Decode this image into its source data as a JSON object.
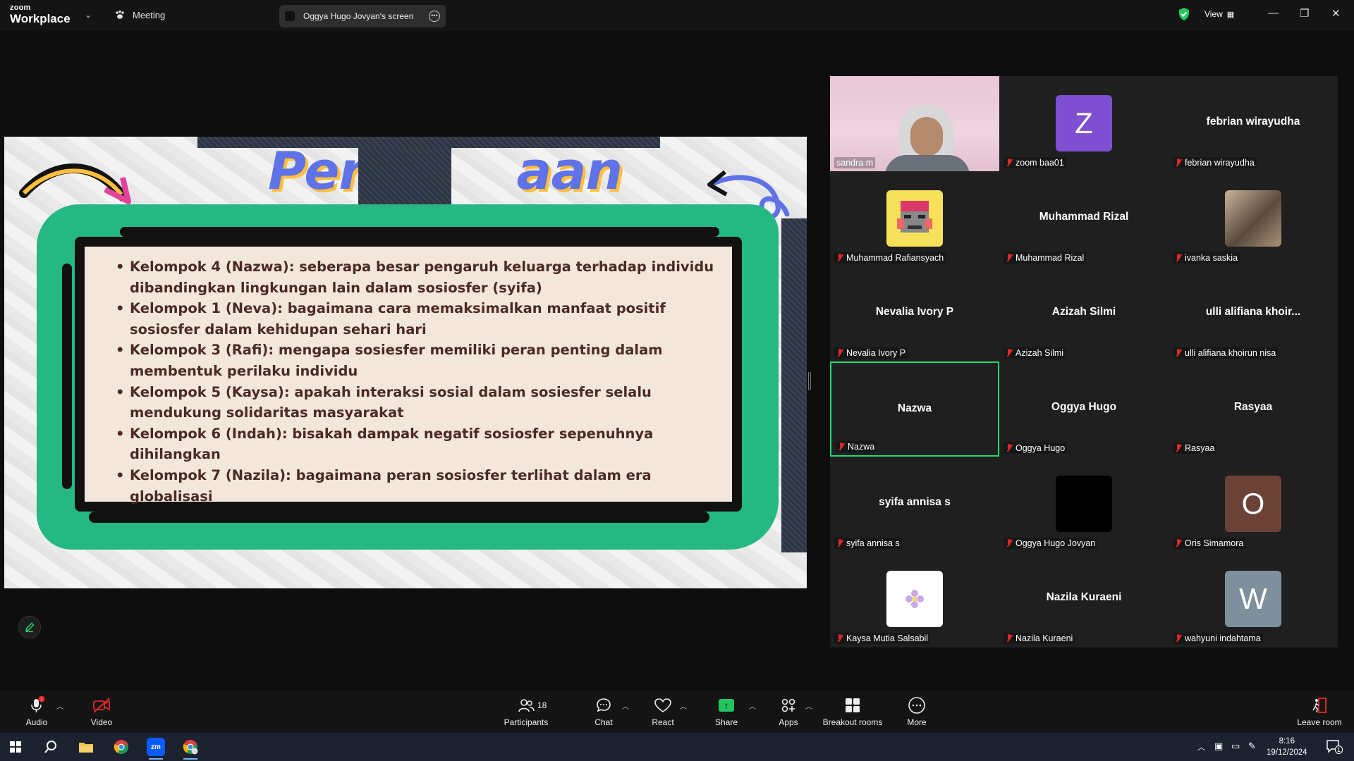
{
  "app": {
    "logo_line1": "zoom",
    "logo_line2": "Workplace",
    "meeting_label": "Meeting",
    "share_indicator": "Oggya Hugo Jovyan's screen",
    "view_label": "View"
  },
  "slide": {
    "title_visible_left": "Pert",
    "title_visible_right": "aan",
    "items": [
      "Kelompok 4 (Nazwa): seberapa besar pengaruh keluarga terhadap individu dibandingkan lingkungan lain dalam sosiosfer (syifa)",
      "Kelompok 1 (Neva): bagaimana cara memaksimalkan manfaat positif sosiosfer dalam kehidupan sehari hari",
      "Kelompok 3 (Rafi): mengapa sosiesfer memiliki peran penting dalam membentuk perilaku individu",
      "Kelompok 5 (Kaysa): apakah interaksi sosial dalam sosiesfer selalu mendukung solidaritas masyarakat",
      "Kelompok 6 (Indah): bisakah dampak negatif sosiosfer sepenuhnya dihilangkan",
      "Kelompok 7 (Nazila): bagaimana peran sosiosfer terlihat dalam era globalisasi"
    ]
  },
  "participants": [
    {
      "label": "sandra m",
      "center": "",
      "avatar": "",
      "kind": "video"
    },
    {
      "label": "zoom baa01",
      "center": "",
      "avatar": "Z",
      "avatar_color": "#7e4fd0",
      "kind": "letter"
    },
    {
      "label": "febrian wirayudha",
      "center": "febrian wirayudha",
      "avatar": "",
      "kind": "name"
    },
    {
      "label": "Muhammad Rafiansyach",
      "center": "",
      "avatar": "",
      "kind": "pixel"
    },
    {
      "label": "Muhammad Rizal",
      "center": "Muhammad Rizal",
      "avatar": "",
      "kind": "name"
    },
    {
      "label": "ivanka saskia",
      "center": "",
      "avatar": "",
      "kind": "photo"
    },
    {
      "label": "Nevalia Ivory P",
      "center": "Nevalia Ivory P",
      "avatar": "",
      "kind": "name"
    },
    {
      "label": "Azizah Silmi",
      "center": "Azizah Silmi",
      "avatar": "",
      "kind": "name"
    },
    {
      "label": "ulli alifiana khoirun nisa",
      "center": "ulli  alifiana  khoir...",
      "avatar": "",
      "kind": "name"
    },
    {
      "label": "Nazwa",
      "center": "Nazwa",
      "avatar": "",
      "kind": "name",
      "active": true
    },
    {
      "label": "Oggya Hugo",
      "center": "Oggya Hugo",
      "avatar": "",
      "kind": "name"
    },
    {
      "label": "Rasyaa",
      "center": "Rasyaa",
      "avatar": "",
      "kind": "name"
    },
    {
      "label": "syifa annisa s",
      "center": "syifa annisa s",
      "avatar": "",
      "kind": "name"
    },
    {
      "label": "Oggya Hugo Jovyan",
      "center": "",
      "avatar": "",
      "avatar_color": "#000000",
      "kind": "letter"
    },
    {
      "label": "Oris Simamora",
      "center": "",
      "avatar": "O",
      "avatar_color": "#6b4336",
      "kind": "letter"
    },
    {
      "label": "Kaysa Mutia Salsabil",
      "center": "",
      "avatar": "",
      "kind": "flower"
    },
    {
      "label": "Nazila Kuraeni",
      "center": "Nazila Kuraeni",
      "avatar": "",
      "kind": "name"
    },
    {
      "label": "wahyuni indahtama",
      "center": "",
      "avatar": "W",
      "avatar_color": "#7d909c",
      "kind": "letter"
    }
  ],
  "toolbar": {
    "audio": "Audio",
    "video": "Video",
    "participants": "Participants",
    "participant_count": "18",
    "chat": "Chat",
    "react": "React",
    "share": "Share",
    "apps": "Apps",
    "breakout": "Breakout rooms",
    "more": "More",
    "leave": "Leave room"
  },
  "taskbar": {
    "time": "8:16",
    "date": "19/12/2024",
    "notif_count": "1"
  },
  "colors": {
    "accent_green": "#23d96f",
    "slide_green": "#25b883",
    "mute_red": "#e02828"
  }
}
